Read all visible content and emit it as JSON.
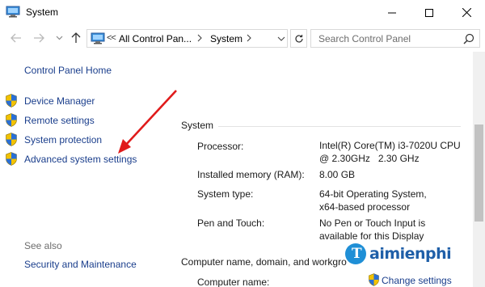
{
  "window": {
    "title": "System",
    "controls": {
      "minimize": "minimize-icon",
      "maximize": "maximize-icon",
      "close": "close-icon"
    }
  },
  "nav": {
    "back_icon": "arrow-left-icon",
    "forward_icon": "arrow-right-icon",
    "recent_icon": "chevron-down-icon",
    "up_icon": "arrow-up-icon",
    "address": {
      "overflow": "<<",
      "crumbs": [
        "All Control Pan...",
        "System"
      ]
    },
    "search": {
      "placeholder": "Search Control Panel"
    }
  },
  "sidebar": {
    "home": "Control Panel Home",
    "items": [
      {
        "label": "Device Manager",
        "icon": "uac-shield-icon"
      },
      {
        "label": "Remote settings",
        "icon": "uac-shield-icon"
      },
      {
        "label": "System protection",
        "icon": "uac-shield-icon"
      },
      {
        "label": "Advanced system settings",
        "icon": "uac-shield-icon"
      }
    ],
    "see_also": "See also",
    "see_also_items": [
      "Security and Maintenance"
    ]
  },
  "main": {
    "system_section": "System",
    "rows": [
      {
        "label": "Processor:",
        "value_lines": [
          "Intel(R) Core(TM) i3-7020U CPU",
          "@ 2.30GHz   2.30 GHz"
        ]
      },
      {
        "label": "Installed memory (RAM):",
        "value_lines": [
          "8.00 GB"
        ]
      },
      {
        "label": "System type:",
        "value_lines": [
          "64-bit Operating System,",
          "x64-based processor"
        ]
      },
      {
        "label": "Pen and Touch:",
        "value_lines": [
          "No Pen or Touch Input is",
          "available for this Display"
        ]
      }
    ],
    "computer_section": "Computer name, domain, and workgro",
    "computer_name_label": "Computer name:",
    "change_settings": "Change settings"
  },
  "watermark": {
    "letter": "T",
    "text": "aimienphi"
  },
  "colors": {
    "link": "#1a3e8c",
    "arrow": "#e01b1b",
    "watermark": "#1f5fa8"
  }
}
